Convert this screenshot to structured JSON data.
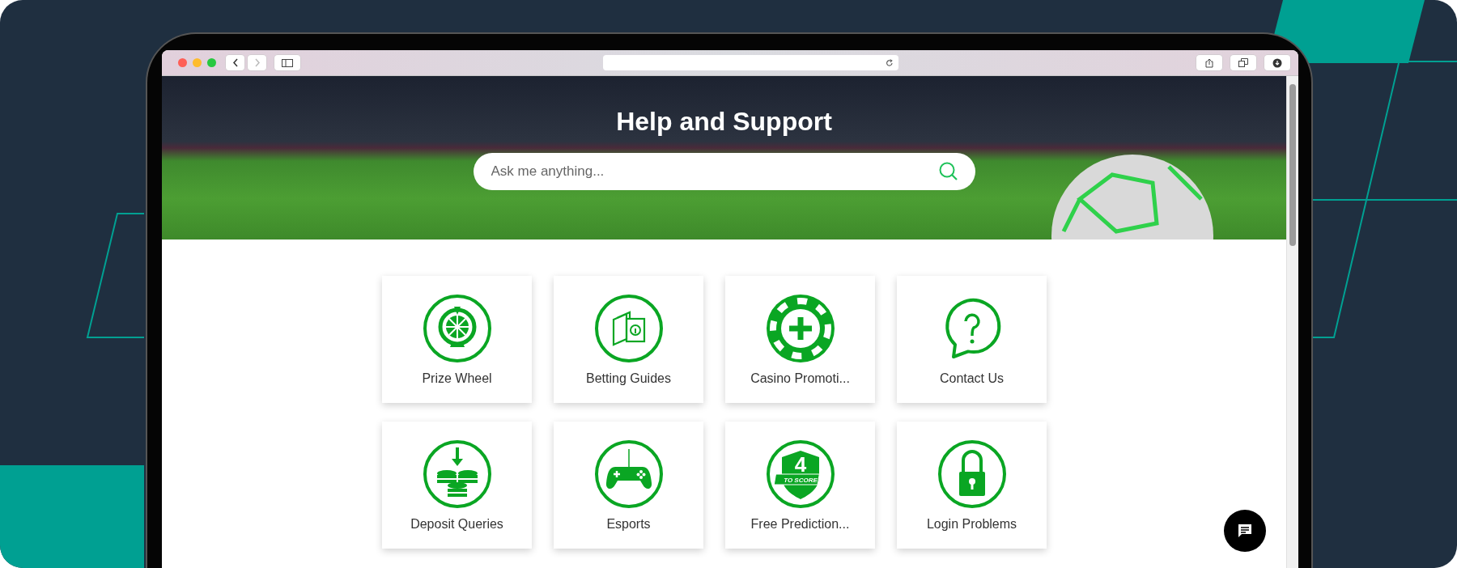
{
  "hero": {
    "title": "Help and Support",
    "search": {
      "placeholder": "Ask me anything..."
    }
  },
  "tiles": [
    {
      "label": "Prize Wheel",
      "kind": "wheel"
    },
    {
      "label": "Betting Guides",
      "kind": "guide"
    },
    {
      "label": "Casino Promoti...",
      "kind": "chip"
    },
    {
      "label": "Contact Us",
      "kind": "question"
    },
    {
      "label": "Deposit Queries",
      "kind": "deposit"
    },
    {
      "label": "Esports",
      "kind": "gamepad"
    },
    {
      "label": "Free Prediction...",
      "kind": "badge",
      "icon_number": "4",
      "icon_text": "TO SCORE"
    },
    {
      "label": "Login Problems",
      "kind": "lock"
    }
  ]
}
